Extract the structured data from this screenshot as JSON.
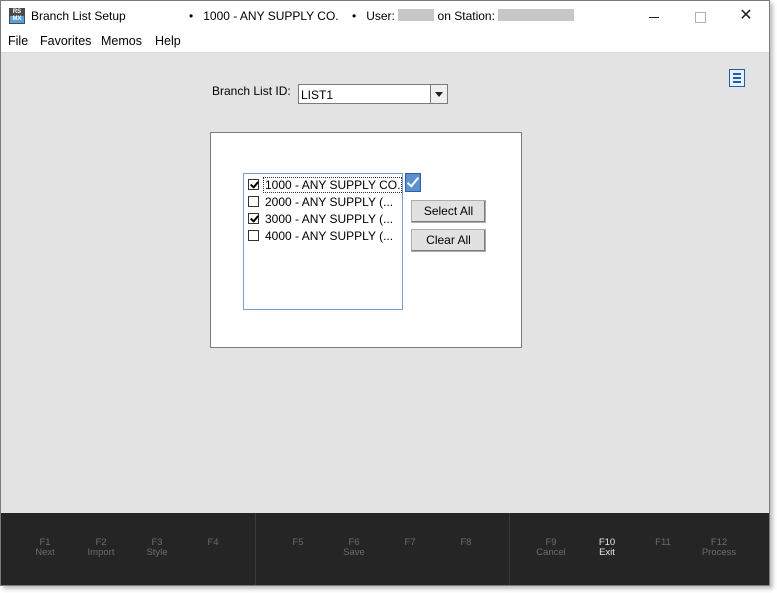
{
  "window": {
    "title": "Branch List Setup",
    "company": "1000 - ANY SUPPLY CO.",
    "user_label": "User:",
    "station_label": "on Station:",
    "bullet": "•"
  },
  "menu": [
    "File",
    "Favorites",
    "Memos",
    "Help"
  ],
  "form": {
    "branch_list_id_label": "Branch List ID:",
    "branch_list_id_value": "LIST1"
  },
  "branches": [
    {
      "label": "1000 - ANY SUPPLY CO.",
      "checked": true
    },
    {
      "label": "2000 - ANY SUPPLY (...",
      "checked": false
    },
    {
      "label": "3000 - ANY SUPPLY (...",
      "checked": true
    },
    {
      "label": "4000 - ANY SUPPLY (...",
      "checked": false
    }
  ],
  "buttons": {
    "select_all": "Select All",
    "clear_all": "Clear All"
  },
  "function_keys": [
    {
      "key": "F1",
      "label": "Next",
      "active": false
    },
    {
      "key": "F2",
      "label": "Import",
      "active": false
    },
    {
      "key": "F3",
      "label": "Style",
      "active": false
    },
    {
      "key": "F4",
      "label": "",
      "active": false
    },
    {
      "key": "F5",
      "label": "",
      "active": false
    },
    {
      "key": "F6",
      "label": "Save",
      "active": false
    },
    {
      "key": "F7",
      "label": "",
      "active": false
    },
    {
      "key": "F8",
      "label": "",
      "active": false
    },
    {
      "key": "F9",
      "label": "Cancel",
      "active": false
    },
    {
      "key": "F10",
      "label": "Exit",
      "active": true
    },
    {
      "key": "F11",
      "label": "",
      "active": false
    },
    {
      "key": "F12",
      "label": "Process",
      "active": false
    }
  ],
  "icons": {
    "app": "rs-mx-app-icon",
    "minimize": "minimize-icon",
    "maximize": "maximize-icon",
    "close": "close-icon",
    "memo_menu": "hamburger-menu-icon",
    "dropdown": "chevron-down-icon",
    "apply_check": "checkmark-icon"
  },
  "colors": {
    "accent": "#5d8fd1",
    "footer_bg": "#252525",
    "window_bg": "#e3e3e3"
  }
}
